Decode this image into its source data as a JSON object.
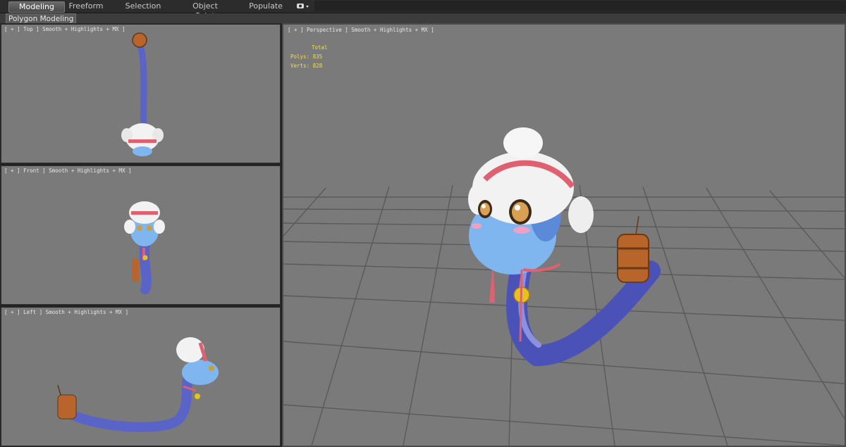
{
  "ribbon": {
    "tabs": [
      {
        "label": "Modeling",
        "active": true
      },
      {
        "label": "Freeform"
      },
      {
        "label": "Selection"
      },
      {
        "label": "Object Paint"
      },
      {
        "label": "Populate"
      }
    ],
    "options_icon": "eye-dropdown-icon"
  },
  "sub_ribbon": {
    "label": "Polygon Modeling"
  },
  "viewports": {
    "top": {
      "label": "[ + ] Top ] Smooth + Highlights + MX ]"
    },
    "front": {
      "label": "[ + ] Front ] Smooth + Highlights + MX ]"
    },
    "left": {
      "label": "[ + ] Left ] Smooth + Highlights + MX ]"
    },
    "perspective": {
      "label": "[ + ] Perspective ] Smooth + Highlights + MX ]",
      "stats": {
        "title": "Total",
        "polys": "Polys: 835",
        "verts": "Verts: 828"
      }
    }
  },
  "colors": {
    "viewport_bg": "#7a7a7a",
    "grid": "#5a5a5a",
    "stats_text": "#f2e03a",
    "snake_body": "#5a63c8",
    "snake_face": "#7fb6f0",
    "hat": "#f2f2f2",
    "hat_band": "#e06070",
    "barrel": "#b8642a"
  }
}
